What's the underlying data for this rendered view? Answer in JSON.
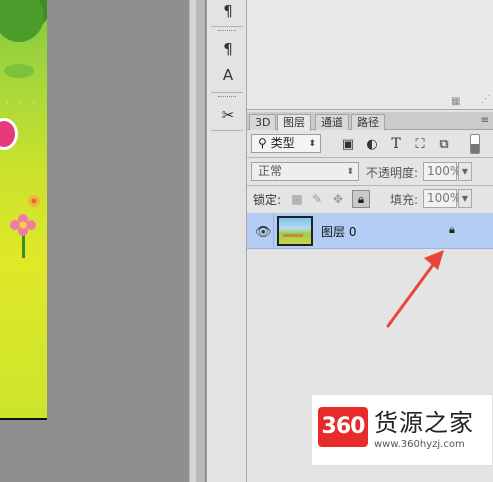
{
  "tools": {
    "paragraph_icon": "¶",
    "paragraph_style_icon": "¶",
    "character_style_icon": "A",
    "tools_icon": "✂"
  },
  "tabs": [
    {
      "label": "3D"
    },
    {
      "label": "图层"
    },
    {
      "label": "通道"
    },
    {
      "label": "路径"
    }
  ],
  "filter": {
    "kind_label": "类型",
    "icons": [
      "image-filter-icon",
      "adjustment-filter-icon",
      "type-filter-icon",
      "shape-filter-icon",
      "smart-object-filter-icon"
    ]
  },
  "blend": {
    "mode": "正常",
    "opacity_label": "不透明度:",
    "opacity_value": "100%"
  },
  "lock": {
    "label": "锁定:",
    "fill_label": "填充:",
    "fill_value": "100%"
  },
  "layers": [
    {
      "name": "图层 0",
      "locked": true
    }
  ],
  "watermark": {
    "badge": "360",
    "title": "货源之家",
    "url": "www.360hyzj.com"
  },
  "colors": {
    "selected_layer": "#b4cdf5",
    "arrow": "#e8463a",
    "badge": "#e82a2a"
  }
}
